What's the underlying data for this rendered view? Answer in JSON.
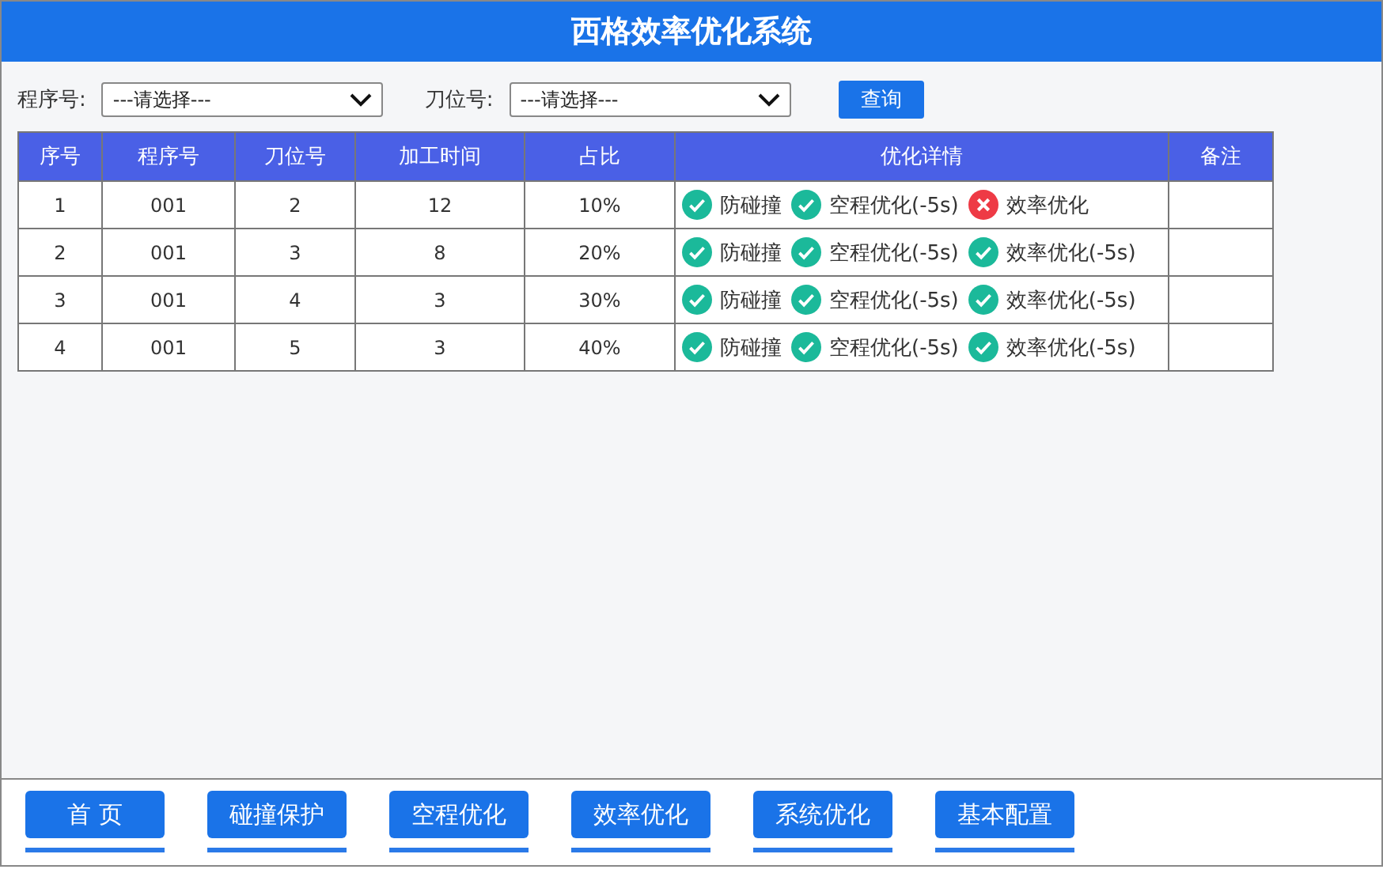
{
  "window": {
    "title": "西格效率优化系统"
  },
  "filters": [
    {
      "label": "程序号:",
      "value": "---请选择---"
    },
    {
      "label": "刀位号:",
      "value": "---请选择---"
    }
  ],
  "query_button": "查询",
  "table": {
    "columns": [
      "序号",
      "程序号",
      "刀位号",
      "加工时间",
      "占比",
      "优化详情",
      "备注"
    ],
    "rows": [
      {
        "cells": [
          "1",
          "001",
          "2",
          "12",
          "10%"
        ],
        "details": [
          {
            "label": "防碰撞",
            "checked": true
          },
          {
            "label": "空程优化(-5s)",
            "checked": true
          },
          {
            "label": "效率优化",
            "checked": false
          }
        ]
      },
      {
        "cells": [
          "2",
          "001",
          "3",
          "8",
          "20%"
        ],
        "details": [
          {
            "label": "防碰撞",
            "checked": true
          },
          {
            "label": "空程优化(-5s)",
            "checked": true
          },
          {
            "label": "效率优化(-5s)",
            "checked": true
          }
        ]
      },
      {
        "cells": [
          "3",
          "001",
          "4",
          "3",
          "30%"
        ],
        "details": [
          {
            "label": "防碰撞",
            "checked": true
          },
          {
            "label": "空程优化(-5s)",
            "checked": true
          },
          {
            "label": "效率优化(-5s)",
            "checked": true
          }
        ]
      },
      {
        "cells": [
          "4",
          "001",
          "5",
          "3",
          "40%"
        ],
        "details": [
          {
            "label": "防碰撞",
            "checked": true
          },
          {
            "label": "空程优化(-5s)",
            "checked": true
          },
          {
            "label": "效率优化(-5s)",
            "checked": true
          }
        ]
      }
    ]
  },
  "nav": [
    "首 页",
    "碰撞保护",
    "空程优化",
    "效率优化",
    "系统优化",
    "基本配置"
  ]
}
